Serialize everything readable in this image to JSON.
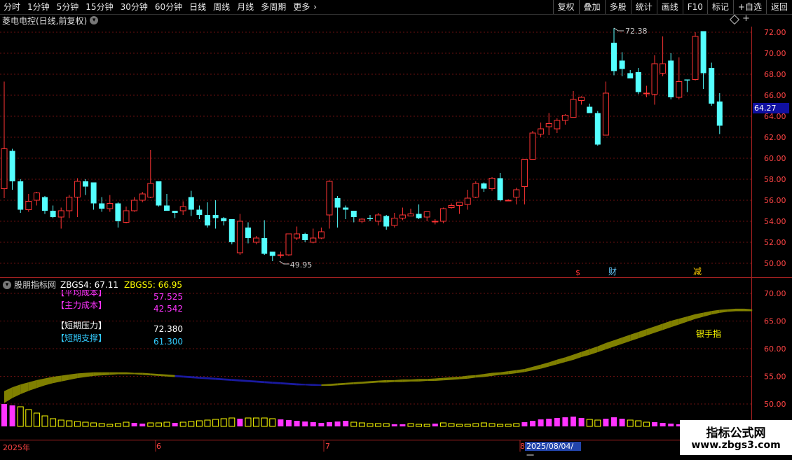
{
  "toolbar": {
    "periods": [
      "分时",
      "1分钟",
      "5分钟",
      "15分钟",
      "30分钟",
      "60分钟",
      "日线",
      "周线",
      "月线",
      "多周期",
      "更多"
    ],
    "more_arrow": "›",
    "right": [
      "复权",
      "叠加",
      "多股",
      "统计",
      "画线",
      "F10",
      "标记",
      "+自选",
      "返回"
    ]
  },
  "header": {
    "title": "菱电电控(日线,前复权)",
    "menu_glyph": "▾"
  },
  "axis": {
    "price_ticks": [
      "72.00",
      "70.00",
      "68.00",
      "66.00",
      "64.00",
      "62.00",
      "60.00",
      "58.00",
      "56.00",
      "54.00",
      "52.00",
      "50.00"
    ],
    "ind_ticks": [
      "70.00",
      "65.00",
      "60.00",
      "55.00",
      "50.00"
    ],
    "current_price": "64.27"
  },
  "annotations": {
    "high": "72.38",
    "low": "49.95",
    "event1": "$",
    "event2": "财",
    "event3": "减"
  },
  "indicator": {
    "name": "股朋指标网",
    "zbgs4": "ZBGS4: 67.11",
    "zbgs5": "ZBGS5: 66.95",
    "legend": [
      {
        "label": "【平均成本】",
        "value": "57.525"
      },
      {
        "label": "【主力成本】",
        "value": "42.542"
      },
      {
        "label": "【短期压力】",
        "value": "72.380"
      },
      {
        "label": "【短期支撑】",
        "value": "61.300"
      }
    ],
    "band_label": "银手指"
  },
  "dates": {
    "year": "2025年",
    "m6": "6",
    "m7": "7",
    "m8": "8",
    "cursor": "2025/08/04/一"
  },
  "watermark": {
    "title": "指标公式网",
    "url": "www.zbgs3.com"
  },
  "colors": {
    "up": "#ff3333",
    "down": "#54ffff",
    "band": "#808000",
    "band_blue": "#1a1aa0",
    "bar_magenta": "#ff33ff",
    "bar_yellow": "#ffff00"
  },
  "chart_data": {
    "type": "candlestick",
    "ylim": [
      49,
      73.5
    ],
    "candles": [
      [
        57.1,
        60.9,
        67.3,
        56.2
      ],
      [
        60.7,
        57.8,
        60.9,
        57.0
      ],
      [
        57.8,
        55.1,
        58.0,
        54.8
      ],
      [
        55.1,
        55.9,
        56.6,
        54.9
      ],
      [
        56.0,
        56.7,
        56.8,
        55.5
      ],
      [
        56.3,
        55.0,
        56.4,
        54.7
      ],
      [
        55.0,
        54.4,
        55.5,
        54.3
      ],
      [
        54.4,
        55.0,
        55.3,
        53.3
      ],
      [
        55.0,
        56.3,
        56.5,
        54.3
      ],
      [
        56.3,
        57.8,
        58.1,
        54.4
      ],
      [
        57.8,
        57.3,
        58.0,
        56.5
      ],
      [
        57.7,
        55.7,
        57.7,
        55.1
      ],
      [
        55.7,
        55.2,
        56.3,
        54.9
      ],
      [
        55.2,
        55.7,
        56.5,
        54.9
      ],
      [
        55.7,
        54.0,
        55.8,
        53.4
      ],
      [
        53.9,
        55.0,
        55.4,
        53.8
      ],
      [
        55.0,
        56.0,
        56.3,
        54.9
      ],
      [
        56.0,
        56.6,
        56.8,
        55.8
      ],
      [
        56.3,
        57.6,
        60.8,
        56.2
      ],
      [
        57.8,
        55.5,
        57.8,
        55.4
      ],
      [
        55.5,
        55.0,
        56.6,
        55.0
      ],
      [
        55.0,
        54.8,
        55.0,
        54.3
      ],
      [
        55.0,
        55.4,
        55.9,
        54.6
      ],
      [
        56.3,
        55.1,
        56.9,
        54.5
      ],
      [
        55.1,
        54.6,
        55.5,
        54.2
      ],
      [
        54.6,
        53.6,
        55.8,
        53.4
      ],
      [
        54.6,
        54.3,
        56.0,
        53.3
      ],
      [
        54.3,
        54.0,
        54.4,
        53.6
      ],
      [
        54.2,
        52.0,
        54.2,
        51.8
      ],
      [
        51.0,
        54.0,
        54.7,
        50.8
      ],
      [
        53.4,
        52.4,
        53.9,
        51.9
      ],
      [
        52.0,
        52.4,
        52.6,
        51.8
      ],
      [
        52.4,
        50.9,
        54.1,
        50.8
      ],
      [
        51.1,
        50.7,
        51.1,
        50.2
      ],
      [
        50.8,
        50.8,
        51.1,
        50.5
      ],
      [
        50.8,
        52.8,
        52.8,
        50.7
      ],
      [
        52.4,
        52.8,
        53.5,
        52.2
      ],
      [
        52.8,
        52.2,
        52.9,
        52.0
      ],
      [
        52.0,
        52.4,
        53.3,
        51.9
      ],
      [
        52.4,
        53.0,
        53.4,
        52.3
      ],
      [
        54.6,
        57.8,
        57.9,
        53.3
      ],
      [
        56.2,
        55.3,
        56.4,
        53.4
      ],
      [
        55.3,
        55.1,
        55.5,
        54.2
      ],
      [
        55.0,
        54.4,
        55.0,
        53.9
      ],
      [
        54.0,
        54.2,
        54.3,
        53.8
      ],
      [
        54.3,
        54.2,
        54.6,
        54.0
      ],
      [
        54.0,
        54.6,
        54.8,
        53.6
      ],
      [
        54.5,
        53.5,
        54.6,
        53.2
      ],
      [
        53.6,
        54.3,
        54.8,
        53.4
      ],
      [
        54.3,
        54.6,
        55.3,
        54.1
      ],
      [
        54.5,
        54.7,
        55.2,
        54.5
      ],
      [
        54.7,
        54.3,
        55.6,
        54.2
      ],
      [
        54.4,
        54.9,
        54.9,
        54.0
      ],
      [
        54.0,
        54.0,
        54.2,
        53.7
      ],
      [
        54.0,
        55.2,
        55.3,
        53.8
      ],
      [
        55.3,
        55.5,
        55.7,
        55.2
      ],
      [
        55.5,
        55.8,
        55.8,
        54.7
      ],
      [
        55.6,
        56.2,
        57.0,
        55.1
      ],
      [
        56.3,
        57.6,
        57.8,
        56.2
      ],
      [
        57.6,
        57.1,
        57.7,
        56.8
      ],
      [
        57.1,
        58.1,
        58.2,
        56.9
      ],
      [
        58.1,
        56.0,
        58.6,
        55.9
      ],
      [
        56.0,
        56.0,
        56.1,
        55.9
      ],
      [
        56.3,
        57.0,
        57.2,
        55.6
      ],
      [
        57.3,
        59.9,
        59.9,
        55.6
      ],
      [
        59.9,
        62.4,
        62.6,
        59.9
      ],
      [
        62.3,
        62.8,
        63.4,
        62.0
      ],
      [
        63.0,
        63.3,
        64.3,
        62.2
      ],
      [
        62.8,
        63.6,
        63.8,
        62.4
      ],
      [
        63.6,
        64.1,
        64.2,
        63.2
      ],
      [
        63.9,
        65.6,
        66.4,
        63.9
      ],
      [
        65.5,
        65.8,
        65.9,
        65.1
      ],
      [
        64.9,
        64.3,
        65.2,
        64.3
      ],
      [
        64.3,
        61.3,
        64.5,
        61.2
      ],
      [
        62.2,
        66.2,
        67.3,
        62.2
      ],
      [
        71.0,
        68.3,
        72.4,
        67.9
      ],
      [
        69.3,
        68.5,
        70.1,
        67.8
      ],
      [
        68.1,
        67.6,
        68.4,
        67.6
      ],
      [
        68.2,
        66.3,
        68.6,
        66.1
      ],
      [
        66.2,
        66.2,
        66.9,
        65.8
      ],
      [
        66.1,
        69.0,
        69.8,
        65.1
      ],
      [
        68.1,
        69.0,
        71.6,
        67.8
      ],
      [
        69.3,
        65.8,
        70.0,
        65.6
      ],
      [
        65.8,
        67.3,
        69.6,
        65.6
      ],
      [
        67.5,
        67.4,
        67.5,
        66.3
      ],
      [
        67.5,
        71.6,
        72.0,
        67.4
      ],
      [
        72.1,
        68.1,
        72.1,
        66.6
      ],
      [
        68.6,
        65.2,
        69.1,
        65.0
      ],
      [
        65.4,
        63.1,
        66.2,
        62.3
      ]
    ],
    "band": [
      [
        50.3,
        52.2
      ],
      [
        51.2,
        52.9
      ],
      [
        51.9,
        53.4
      ],
      [
        52.5,
        53.8
      ],
      [
        53.0,
        54.2
      ],
      [
        53.5,
        54.5
      ],
      [
        53.9,
        54.8
      ],
      [
        54.2,
        55.0
      ],
      [
        54.5,
        55.2
      ],
      [
        54.8,
        55.4
      ],
      [
        55.0,
        55.5
      ],
      [
        55.2,
        55.6
      ],
      [
        55.3,
        55.6
      ],
      [
        55.4,
        55.6
      ],
      [
        55.5,
        55.6
      ],
      [
        55.5,
        55.6
      ],
      [
        55.5,
        55.5
      ],
      [
        55.4,
        55.5
      ],
      [
        55.3,
        55.4
      ],
      [
        55.2,
        55.3
      ],
      [
        55.1,
        55.2
      ],
      [
        55.0,
        55.1
      ],
      [
        54.9,
        55.0
      ],
      [
        54.8,
        54.9
      ],
      [
        54.7,
        54.8
      ],
      [
        54.6,
        54.7
      ],
      [
        54.5,
        54.6
      ],
      [
        54.4,
        54.5
      ],
      [
        54.3,
        54.4
      ],
      [
        54.2,
        54.3
      ],
      [
        54.1,
        54.2
      ],
      [
        54.0,
        54.1
      ],
      [
        53.9,
        54.0
      ],
      [
        53.8,
        53.9
      ],
      [
        53.7,
        53.8
      ],
      [
        53.6,
        53.7
      ],
      [
        53.5,
        53.6
      ],
      [
        53.5,
        53.5
      ],
      [
        53.4,
        53.5
      ],
      [
        53.4,
        53.4
      ],
      [
        53.4,
        53.5
      ],
      [
        53.5,
        53.6
      ],
      [
        53.6,
        53.7
      ],
      [
        53.7,
        53.8
      ],
      [
        53.8,
        53.9
      ],
      [
        53.9,
        54.0
      ],
      [
        54.0,
        54.1
      ],
      [
        54.0,
        54.2
      ],
      [
        54.1,
        54.2
      ],
      [
        54.1,
        54.3
      ],
      [
        54.2,
        54.3
      ],
      [
        54.2,
        54.4
      ],
      [
        54.3,
        54.4
      ],
      [
        54.3,
        54.5
      ],
      [
        54.4,
        54.6
      ],
      [
        54.5,
        54.7
      ],
      [
        54.6,
        54.8
      ],
      [
        54.7,
        55.0
      ],
      [
        54.9,
        55.1
      ],
      [
        55.0,
        55.3
      ],
      [
        55.2,
        55.5
      ],
      [
        55.4,
        55.6
      ],
      [
        55.5,
        55.8
      ],
      [
        55.7,
        56.0
      ],
      [
        55.9,
        56.2
      ],
      [
        56.2,
        56.6
      ],
      [
        56.5,
        57.0
      ],
      [
        56.9,
        57.4
      ],
      [
        57.3,
        57.9
      ],
      [
        57.7,
        58.3
      ],
      [
        58.1,
        58.8
      ],
      [
        58.6,
        59.3
      ],
      [
        59.0,
        59.8
      ],
      [
        59.5,
        60.3
      ],
      [
        60.0,
        60.9
      ],
      [
        60.5,
        61.4
      ],
      [
        61.0,
        61.9
      ],
      [
        61.5,
        62.4
      ],
      [
        62.0,
        62.9
      ],
      [
        62.5,
        63.4
      ],
      [
        63.0,
        63.9
      ],
      [
        63.5,
        64.4
      ],
      [
        64.0,
        64.9
      ],
      [
        64.5,
        65.3
      ],
      [
        65.0,
        65.7
      ],
      [
        65.5,
        66.1
      ],
      [
        65.9,
        66.4
      ],
      [
        66.3,
        66.7
      ],
      [
        66.6,
        66.9
      ],
      [
        66.8,
        67.0
      ],
      [
        66.9,
        67.1
      ],
      [
        66.9,
        67.1
      ],
      [
        66.9,
        67.0
      ]
    ],
    "bars": [
      [
        3.2,
        "m"
      ],
      [
        3.0,
        "m"
      ],
      [
        2.8,
        "y"
      ],
      [
        2.4,
        "y"
      ],
      [
        1.9,
        "y"
      ],
      [
        1.5,
        "y"
      ],
      [
        1.1,
        "y"
      ],
      [
        0.9,
        "y"
      ],
      [
        0.8,
        "y"
      ],
      [
        0.7,
        "y"
      ],
      [
        0.6,
        "y"
      ],
      [
        0.5,
        "y"
      ],
      [
        0.4,
        "y"
      ],
      [
        0.3,
        "y"
      ],
      [
        0.4,
        "y"
      ],
      [
        0.6,
        "y"
      ],
      [
        0.5,
        "m"
      ],
      [
        0.4,
        "m"
      ],
      [
        0.5,
        "y"
      ],
      [
        0.5,
        "y"
      ],
      [
        0.6,
        "y"
      ],
      [
        0.5,
        "m"
      ],
      [
        0.6,
        "y"
      ],
      [
        0.7,
        "y"
      ],
      [
        0.8,
        "y"
      ],
      [
        0.9,
        "y"
      ],
      [
        1.0,
        "y"
      ],
      [
        1.1,
        "y"
      ],
      [
        1.2,
        "y"
      ],
      [
        1.1,
        "m"
      ],
      [
        1.2,
        "y"
      ],
      [
        1.2,
        "y"
      ],
      [
        1.2,
        "y"
      ],
      [
        1.1,
        "y"
      ],
      [
        1.0,
        "m"
      ],
      [
        0.9,
        "m"
      ],
      [
        0.8,
        "m"
      ],
      [
        0.7,
        "m"
      ],
      [
        0.6,
        "m"
      ],
      [
        0.5,
        "m"
      ],
      [
        0.6,
        "m"
      ],
      [
        0.7,
        "m"
      ],
      [
        0.8,
        "m"
      ],
      [
        0.6,
        "y"
      ],
      [
        0.5,
        "y"
      ],
      [
        0.4,
        "y"
      ],
      [
        0.4,
        "y"
      ],
      [
        0.4,
        "y"
      ],
      [
        0.3,
        "m"
      ],
      [
        0.3,
        "m"
      ],
      [
        0.4,
        "y"
      ],
      [
        0.3,
        "y"
      ],
      [
        0.3,
        "y"
      ],
      [
        0.4,
        "m"
      ],
      [
        0.5,
        "y"
      ],
      [
        0.4,
        "y"
      ],
      [
        0.3,
        "y"
      ],
      [
        0.3,
        "y"
      ],
      [
        0.4,
        "y"
      ],
      [
        0.5,
        "y"
      ],
      [
        0.4,
        "y"
      ],
      [
        0.3,
        "y"
      ],
      [
        0.3,
        "y"
      ],
      [
        0.4,
        "y"
      ],
      [
        0.6,
        "m"
      ],
      [
        0.8,
        "m"
      ],
      [
        1.0,
        "m"
      ],
      [
        1.1,
        "m"
      ],
      [
        1.2,
        "m"
      ],
      [
        1.3,
        "m"
      ],
      [
        1.4,
        "m"
      ],
      [
        1.2,
        "m"
      ],
      [
        1.0,
        "y"
      ],
      [
        0.9,
        "y"
      ],
      [
        1.1,
        "m"
      ],
      [
        1.3,
        "m"
      ],
      [
        1.1,
        "m"
      ],
      [
        0.9,
        "y"
      ],
      [
        0.8,
        "y"
      ],
      [
        0.6,
        "y"
      ],
      [
        0.6,
        "m"
      ],
      [
        0.5,
        "m"
      ],
      [
        0.4,
        "m"
      ],
      [
        0.3,
        "m"
      ],
      [
        0.3,
        "y"
      ],
      [
        0.2,
        "y"
      ],
      [
        0.2,
        "y"
      ],
      [
        0.2,
        "m"
      ],
      [
        0.2,
        "y"
      ]
    ]
  }
}
